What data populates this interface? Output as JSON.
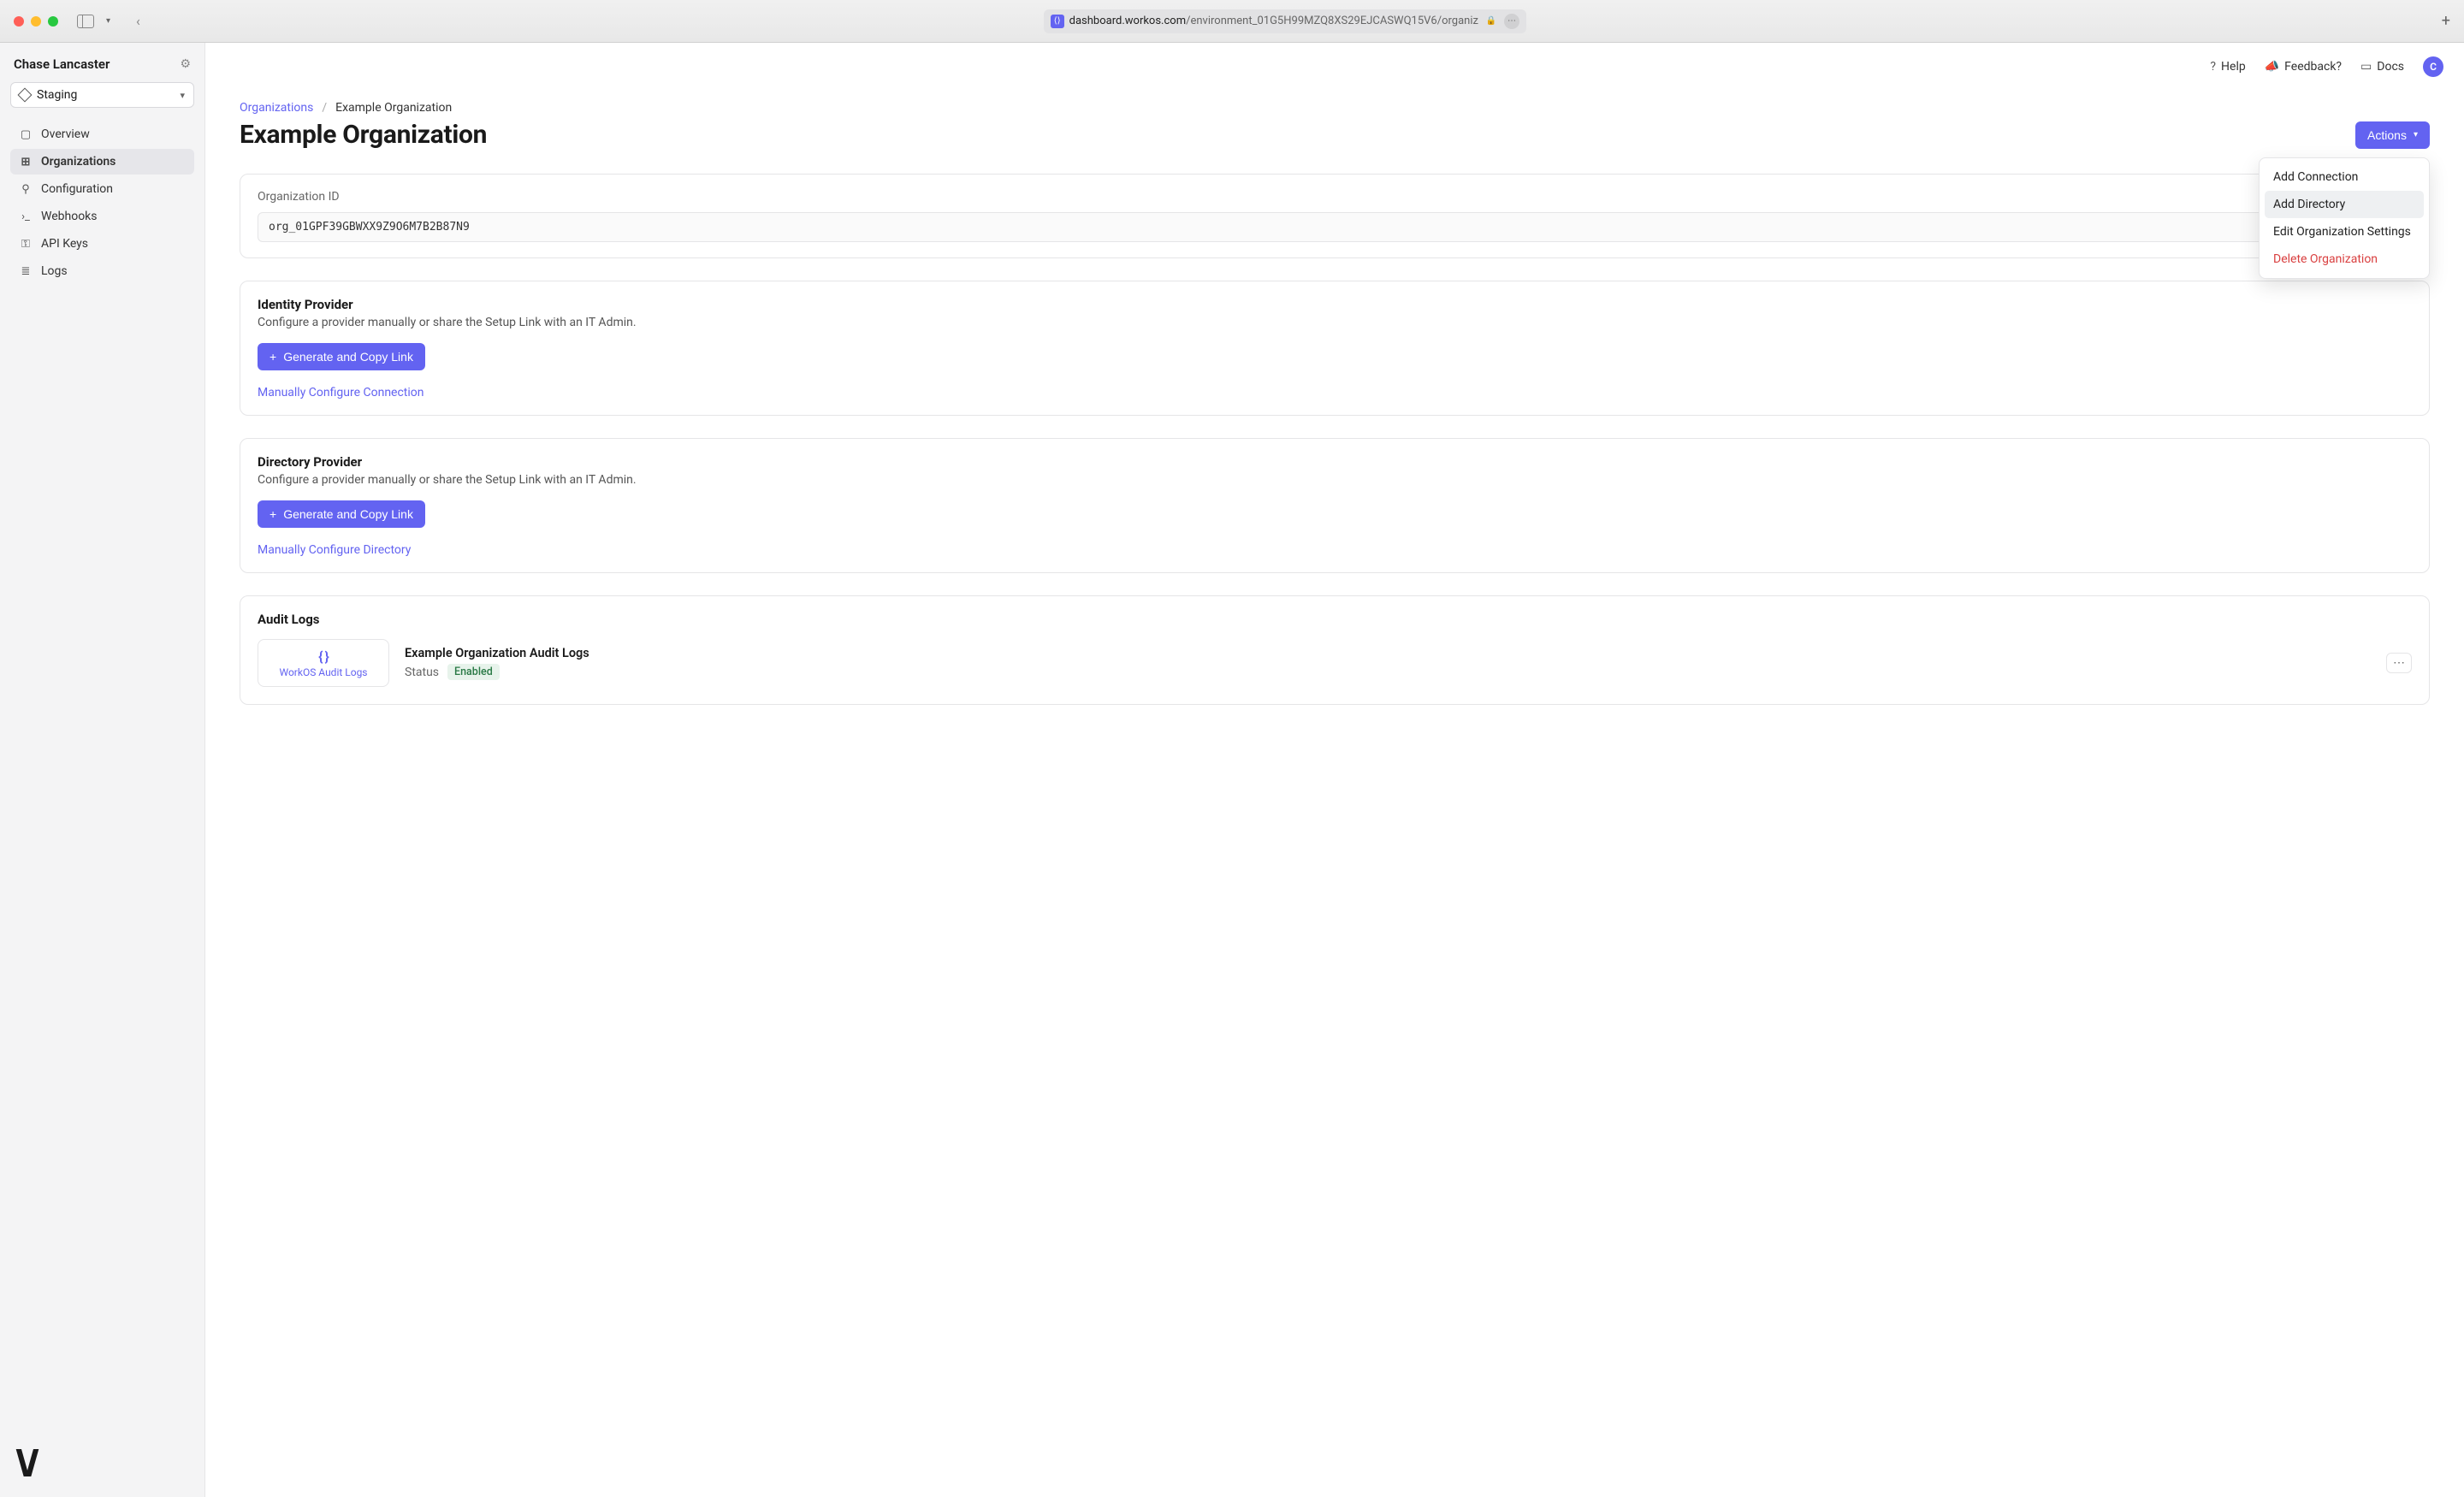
{
  "browser": {
    "url_domain": "dashboard.workos.com",
    "url_path": "/environment_01G5H99MZQ8XS29EJCASWQ15V6/organiz"
  },
  "sidebar": {
    "user_name": "Chase Lancaster",
    "environment": "Staging",
    "items": [
      {
        "label": "Overview",
        "active": false
      },
      {
        "label": "Organizations",
        "active": true
      },
      {
        "label": "Configuration",
        "active": false
      },
      {
        "label": "Webhooks",
        "active": false
      },
      {
        "label": "API Keys",
        "active": false
      },
      {
        "label": "Logs",
        "active": false
      }
    ]
  },
  "topbar": {
    "help": "Help",
    "feedback": "Feedback?",
    "docs": "Docs",
    "avatar_initial": "C"
  },
  "breadcrumb": {
    "root": "Organizations",
    "current": "Example Organization"
  },
  "page": {
    "title": "Example Organization",
    "actions_label": "Actions"
  },
  "actions_menu": {
    "items": [
      {
        "label": "Add Connection",
        "selected": false,
        "danger": false
      },
      {
        "label": "Add Directory",
        "selected": true,
        "danger": false
      },
      {
        "label": "Edit Organization Settings",
        "selected": false,
        "danger": false
      },
      {
        "label": "Delete Organization",
        "selected": false,
        "danger": true
      }
    ]
  },
  "org_id": {
    "label": "Organization ID",
    "value": "org_01GPF39GBWXX9Z9O6M7B2B87N9"
  },
  "identity": {
    "title": "Identity Provider",
    "desc": "Configure a provider manually or share the Setup Link with an IT Admin.",
    "button": "Generate and Copy Link",
    "link": "Manually Configure Connection"
  },
  "directory": {
    "title": "Directory Provider",
    "desc": "Configure a provider manually or share the Setup Link with an IT Admin.",
    "button": "Generate and Copy Link",
    "link": "Manually Configure Directory"
  },
  "audit": {
    "heading": "Audit Logs",
    "tile_label": "WorkOS Audit Logs",
    "item_title": "Example Organization Audit Logs",
    "status_label": "Status",
    "status_value": "Enabled"
  }
}
